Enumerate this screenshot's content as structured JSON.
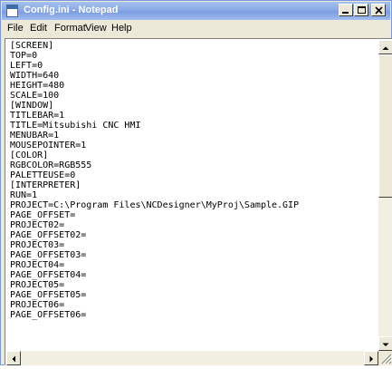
{
  "window": {
    "title": "Config.ini - Notepad"
  },
  "menu": {
    "file": "File",
    "edit": "Edit",
    "format": "Format",
    "view": "View",
    "help": "Help"
  },
  "content": {
    "lines": [
      "[SCREEN]",
      "TOP=0",
      "LEFT=0",
      "WIDTH=640",
      "HEIGHT=480",
      "SCALE=100",
      "[WINDOW]",
      "TITLEBAR=1",
      "TITLE=Mitsubishi CNC HMI",
      "MENUBAR=1",
      "MOUSEPOINTER=1",
      "[COLOR]",
      "RGBCOLOR=RGB555",
      "PALETTEUSE=0",
      "[INTERPRETER]",
      "RUN=1",
      "PROJECT=C:\\Program Files\\NCDesigner\\MyProj\\Sample.GIP",
      "PAGE_OFFSET=",
      "PROJECT02=",
      "PAGE_OFFSET02=",
      "PROJECT03=",
      "PAGE_OFFSET03=",
      "PROJECT04=",
      "PAGE_OFFSET04=",
      "PROJECT05=",
      "PAGE_OFFSET05=",
      "PROJECT06=",
      "PAGE_OFFSET06="
    ]
  },
  "icons": {
    "app": "notepad-icon",
    "minimize": "minimize-icon",
    "maximize": "maximize-icon",
    "close": "close-icon",
    "scroll_up": "arrow-up-icon",
    "scroll_down": "arrow-down-icon",
    "scroll_left": "arrow-left-icon",
    "scroll_right": "arrow-right-icon"
  }
}
